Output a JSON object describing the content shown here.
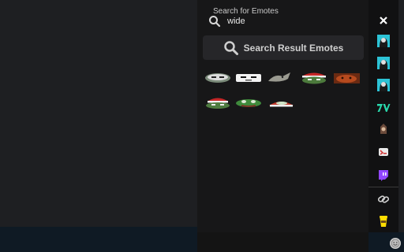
{
  "search": {
    "label": "Search for Emotes",
    "value": "wide"
  },
  "results": {
    "header": "Search Result Emotes"
  },
  "emotes": [
    "emote-1",
    "emote-2",
    "emote-3",
    "emote-4",
    "emote-5",
    "emote-6",
    "emote-7",
    "emote-8"
  ],
  "sidebar": {
    "items": [
      "close-icon",
      "streamer-avatar-1",
      "streamer-avatar-2",
      "streamer-avatar-3",
      "7tv-icon",
      "bttv-icon",
      "ffz-icon",
      "twitch-icon",
      "link-icon",
      "coffee-cup-icon"
    ]
  },
  "colors": {
    "accent_twitch": "#9146ff",
    "accent_7tv": "#29d8ac",
    "accent_teal": "#2cc3d6"
  }
}
